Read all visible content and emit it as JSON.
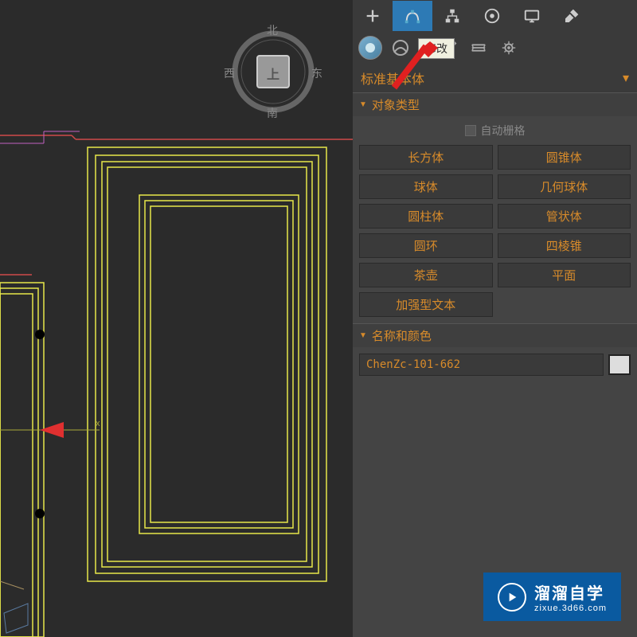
{
  "viewcube": {
    "n": "北",
    "s": "南",
    "e": "东",
    "w": "西",
    "face": "上"
  },
  "tooltip": "修改",
  "dropdown": {
    "label": "标准基本体"
  },
  "sections": {
    "object_type": {
      "title": "对象类型",
      "autogrid": "自动栅格",
      "buttons": [
        "长方体",
        "圆锥体",
        "球体",
        "几何球体",
        "圆柱体",
        "管状体",
        "圆环",
        "四棱锥",
        "茶壶",
        "平面",
        "加强型文本"
      ]
    },
    "name_color": {
      "title": "名称和颜色",
      "name_value": "ChenZc-101-662"
    }
  },
  "watermark": {
    "cn": "溜溜自学",
    "url": "zixue.3d66.com"
  }
}
